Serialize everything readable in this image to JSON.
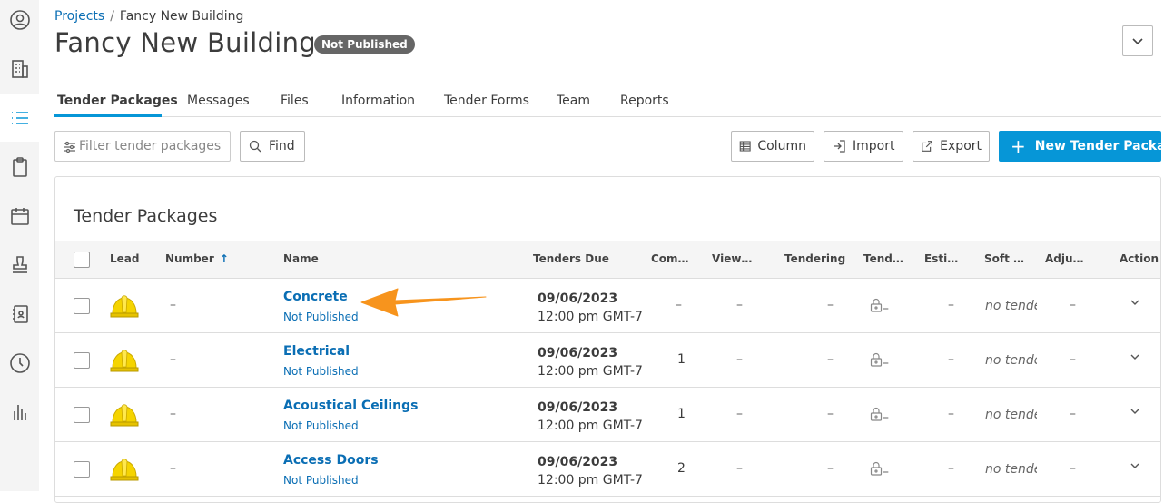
{
  "breadcrumb": {
    "root": "Projects",
    "separator": "/",
    "current": "Fancy New Building"
  },
  "header": {
    "title": "Fancy New Building",
    "status_badge": "Not Published"
  },
  "tabs": [
    {
      "label": "Tender Packages",
      "active": true
    },
    {
      "label": "Messages"
    },
    {
      "label": "Files"
    },
    {
      "label": "Information"
    },
    {
      "label": "Tender Forms"
    },
    {
      "label": "Team"
    },
    {
      "label": "Reports"
    }
  ],
  "toolbar": {
    "filter_placeholder": "Filter tender packages",
    "find_label": "Find",
    "column_label": "Column",
    "import_label": "Import",
    "export_label": "Export",
    "new_package_label": "New Tender Package"
  },
  "panel": {
    "title": "Tender Packages"
  },
  "table": {
    "columns": [
      "Lead",
      "Number",
      "Name",
      "Tenders Due",
      "Com…",
      "View…",
      "Tendering",
      "Tend…",
      "Esti…",
      "Soft …",
      "Adju…",
      "Action"
    ],
    "sort_indicator": "↑",
    "rows": [
      {
        "number": "–",
        "name": "Concrete",
        "status": "Not Published",
        "due_date": "09/06/2023",
        "due_time": "12:00 pm GMT-7",
        "com": "–",
        "view": "–",
        "tendering": "–",
        "tend": "–",
        "esti": "–",
        "soft": "no tende",
        "adju": "–"
      },
      {
        "number": "–",
        "name": "Electrical",
        "status": "Not Published",
        "due_date": "09/06/2023",
        "due_time": "12:00 pm GMT-7",
        "com": "1",
        "view": "–",
        "tendering": "–",
        "tend": "–",
        "esti": "–",
        "soft": "no tende",
        "adju": "–"
      },
      {
        "number": "–",
        "name": "Acoustical Ceilings",
        "status": "Not Published",
        "due_date": "09/06/2023",
        "due_time": "12:00 pm GMT-7",
        "com": "1",
        "view": "–",
        "tendering": "–",
        "tend": "–",
        "esti": "–",
        "soft": "no tende",
        "adju": "–"
      },
      {
        "number": "–",
        "name": "Access Doors",
        "status": "Not Published",
        "due_date": "09/06/2023",
        "due_time": "12:00 pm GMT-7",
        "com": "2",
        "view": "–",
        "tendering": "–",
        "tend": "–",
        "esti": "–",
        "soft": "no tende",
        "adju": "–"
      }
    ]
  },
  "sidebar": {
    "items": [
      {
        "icon": "user-icon"
      },
      {
        "icon": "building-icon"
      },
      {
        "icon": "list-icon",
        "active": true
      },
      {
        "icon": "clipboard-icon"
      },
      {
        "icon": "calendar-icon"
      },
      {
        "icon": "stamp-icon"
      },
      {
        "icon": "address-book-icon"
      },
      {
        "icon": "clock-icon"
      },
      {
        "icon": "bar-chart-icon"
      }
    ]
  },
  "colors": {
    "accent": "#0696d7",
    "link": "#0a6eb4",
    "badge": "#666666",
    "annotation": "#f7941d"
  }
}
